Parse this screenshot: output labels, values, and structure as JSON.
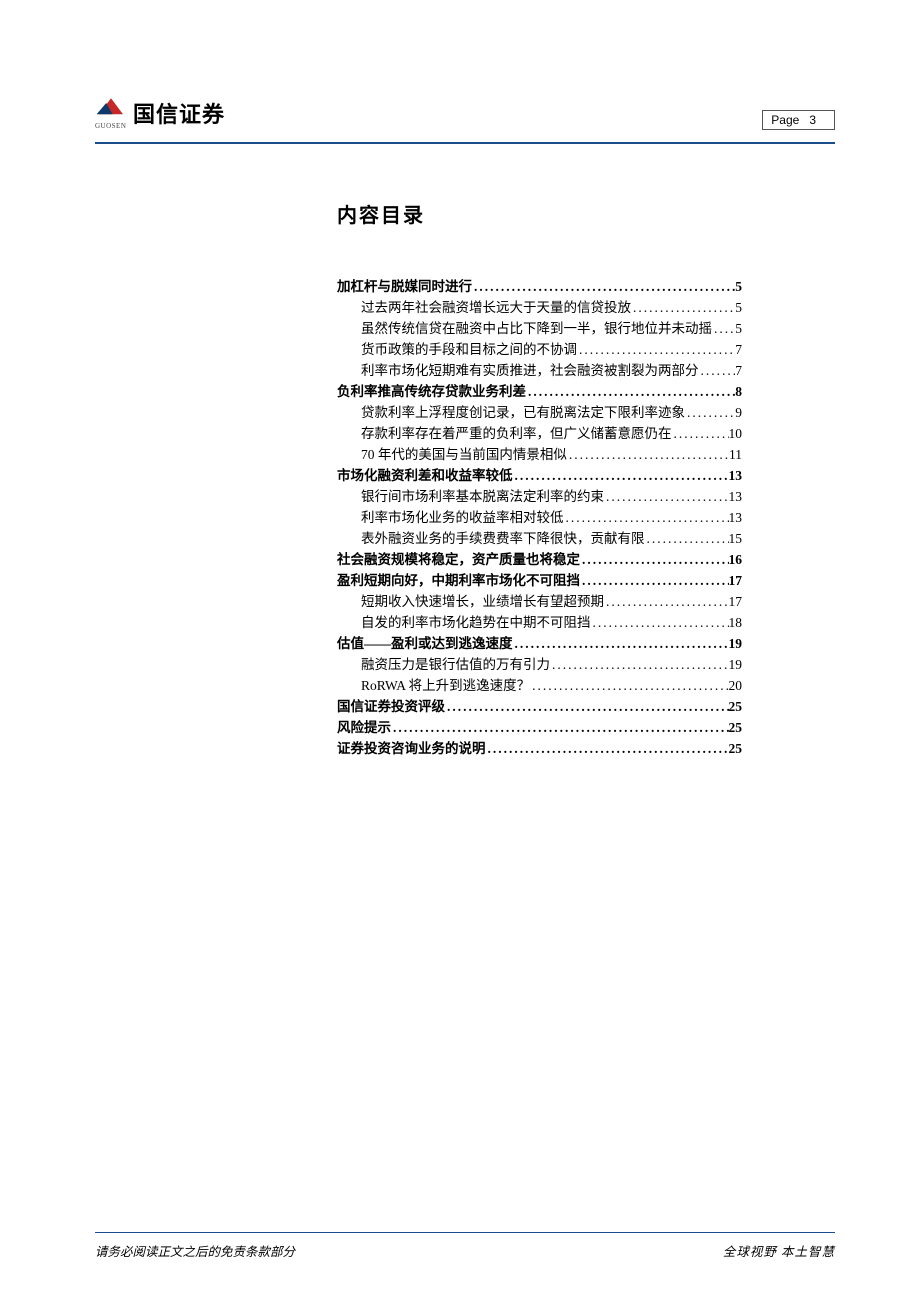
{
  "header": {
    "company_name": "国信证券",
    "logo_subtext": "GUOSEN",
    "page_label": "Page",
    "page_number": "3"
  },
  "toc": {
    "title": "内容目录",
    "entries": [
      {
        "level": 1,
        "text": "加杠杆与脱媒同时进行",
        "page": "5"
      },
      {
        "level": 2,
        "text": "过去两年社会融资增长远大于天量的信贷投放",
        "page": "5"
      },
      {
        "level": 2,
        "text": "虽然传统信贷在融资中占比下降到一半，银行地位并未动摇",
        "page": "5"
      },
      {
        "level": 2,
        "text": "货币政策的手段和目标之间的不协调",
        "page": "7"
      },
      {
        "level": 2,
        "text": "利率市场化短期难有实质推进，社会融资被割裂为两部分",
        "page": "7"
      },
      {
        "level": 1,
        "text": "负利率推高传统存贷款业务利差",
        "page": "8"
      },
      {
        "level": 2,
        "text": "贷款利率上浮程度创记录，已有脱离法定下限利率迹象",
        "page": "9"
      },
      {
        "level": 2,
        "text": "存款利率存在着严重的负利率，但广义储蓄意愿仍在",
        "page": "10"
      },
      {
        "level": 2,
        "text": "70 年代的美国与当前国内情景相似",
        "page": "11"
      },
      {
        "level": 1,
        "text": "市场化融资利差和收益率较低",
        "page": "13"
      },
      {
        "level": 2,
        "text": "银行间市场利率基本脱离法定利率的约束",
        "page": "13"
      },
      {
        "level": 2,
        "text": "利率市场化业务的收益率相对较低",
        "page": "13"
      },
      {
        "level": 2,
        "text": "表外融资业务的手续费费率下降很快，贡献有限",
        "page": "15"
      },
      {
        "level": 1,
        "text": "社会融资规模将稳定，资产质量也将稳定",
        "page": "16"
      },
      {
        "level": 1,
        "text": "盈利短期向好，中期利率市场化不可阻挡",
        "page": "17"
      },
      {
        "level": 2,
        "text": "短期收入快速增长，业绩增长有望超预期",
        "page": "17"
      },
      {
        "level": 2,
        "text": "自发的利率市场化趋势在中期不可阻挡",
        "page": "18"
      },
      {
        "level": 1,
        "text": "估值——盈利或达到逃逸速度",
        "page": "19"
      },
      {
        "level": 2,
        "text": "融资压力是银行估值的万有引力",
        "page": "19"
      },
      {
        "level": 2,
        "text": "RoRWA 将上升到逃逸速度？",
        "page": "20"
      },
      {
        "level": 1,
        "text": "国信证券投资评级",
        "page": "25"
      },
      {
        "level": 1,
        "text": "风险提示",
        "page": "25"
      },
      {
        "level": 1,
        "text": "证券投资咨询业务的说明",
        "page": "25"
      }
    ]
  },
  "footer": {
    "left": "请务必阅读正文之后的免责条款部分",
    "right": "全球视野 本土智慧"
  }
}
